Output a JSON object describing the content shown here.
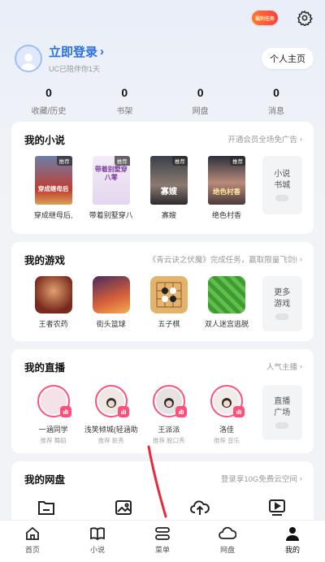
{
  "header": {
    "badge_text": "福利任务",
    "settings_icon": "gear-icon"
  },
  "profile": {
    "login_label": "立即登录",
    "subtitle": "UC已陪伴你1天",
    "homepage_button": "个人主页"
  },
  "stats": [
    {
      "value": "0",
      "label": "收藏/历史"
    },
    {
      "value": "0",
      "label": "书架"
    },
    {
      "value": "0",
      "label": "网盘"
    },
    {
      "value": "0",
      "label": "消息"
    }
  ],
  "novels": {
    "title": "我的小说",
    "link": "开通会员全场免广告",
    "books": [
      {
        "label": "穿成继母后,",
        "tag": "推荐",
        "cover_text": "穿成继母后"
      },
      {
        "label": "带着别墅穿八",
        "tag": "推荐",
        "cover_text": "带着别墅穿八零"
      },
      {
        "label": "寡嫂",
        "tag": "推荐",
        "cover_text": "寡嫂"
      },
      {
        "label": "绝色村香",
        "tag": "推荐",
        "cover_text": "绝色村香"
      }
    ],
    "more": [
      "小说",
      "书城"
    ]
  },
  "games": {
    "title": "我的游戏",
    "link": "《青云诀之伏魔》完成任务，赢取限量飞剑!",
    "items": [
      {
        "label": "王者农药"
      },
      {
        "label": "街头篮球"
      },
      {
        "label": "五子棋"
      },
      {
        "label": "双人迷宫逃脱"
      }
    ],
    "more": [
      "更多",
      "游戏"
    ]
  },
  "live": {
    "title": "我的直播",
    "link": "人气主播",
    "items": [
      {
        "name": "一涵同学",
        "sub": "推荐 舞蹈"
      },
      {
        "name": "浅笑倾城(轻涵助…",
        "sub": "推荐 新秀"
      },
      {
        "name": "王派派",
        "sub": "推荐 脱口秀"
      },
      {
        "name": "洛佳",
        "sub": "推荐 音乐"
      }
    ],
    "more": [
      "直播",
      "广场"
    ]
  },
  "disk": {
    "title": "我的网盘",
    "link": "登录享10G免费云空间",
    "icons": [
      "folder-icon",
      "image-icon",
      "cloud-upload-icon",
      "video-icon"
    ]
  },
  "tabbar": [
    {
      "label": "首页",
      "icon": "home-icon"
    },
    {
      "label": "小说",
      "icon": "book-icon"
    },
    {
      "label": "菜单",
      "icon": "menu-icon"
    },
    {
      "label": "网盘",
      "icon": "cloud-icon"
    },
    {
      "label": "我的",
      "icon": "user-icon"
    }
  ],
  "colors": {
    "accent": "#2a6fe8",
    "live_ring": "#ff4f7b",
    "annotation": "#e8293b"
  }
}
